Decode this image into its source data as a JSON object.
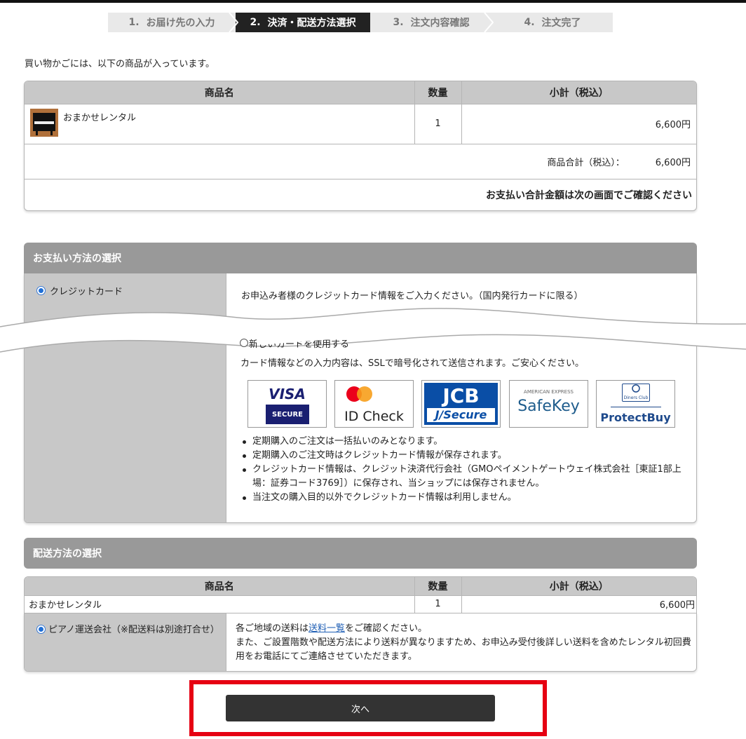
{
  "steps": [
    {
      "num": "1.",
      "label": "お届け先の入力"
    },
    {
      "num": "2.",
      "label": "決済・配送方法選択"
    },
    {
      "num": "3.",
      "label": "注文内容確認"
    },
    {
      "num": "4.",
      "label": "注文完了"
    }
  ],
  "intro_text": "買い物かごには、以下の商品が入っています。",
  "cart": {
    "headers": [
      "商品名",
      "数量",
      "小計（税込）"
    ],
    "item": {
      "name": "おまかせレンタル",
      "qty": "1",
      "subtotal": "6,600円",
      "thumb_icon": "piano-thumbnail"
    },
    "total_label": "商品合計（税込）：",
    "total_value": "6,600円",
    "notice": "お支払い合計金額は次の画面でご確認ください"
  },
  "payment": {
    "title": "お支払い方法の選択",
    "option_label": "クレジットカード",
    "instruction": "お申込み者様のクレジットカード情報をご入力ください。（国内発行カードに限る）",
    "new_card_label": "新しいカードを使用する",
    "ssl_text": "カード情報などの入力内容は、SSLで暗号化されて送信されます。ご安心ください。",
    "logos": [
      {
        "icon": "visa-secure-logo",
        "line1": "VISA",
        "line2": "SECURE"
      },
      {
        "icon": "mastercard-id-check-logo",
        "line1": "ID Check"
      },
      {
        "icon": "jcb-j-secure-logo",
        "line1": "JCB",
        "line2": "J/Secure"
      },
      {
        "icon": "amex-safekey-logo",
        "line1": "AMERICAN EXPRESS",
        "line2": "SafeKey"
      },
      {
        "icon": "diners-protectbuy-logo",
        "line1": "Diners Club",
        "line2": "ProtectBuy"
      }
    ],
    "notes": [
      "定期購入のご注文は一括払いのみとなります。",
      "定期購入のご注文時はクレジットカード情報が保存されます。",
      "クレジットカード情報は、クレジット決済代行会社（GMOペイメントゲートウェイ株式会社［東証1部上場：証券コード3769］）に保存され、当ショップには保存されません。",
      "当注文の購入目的以外でクレジットカード情報は利用しません。"
    ]
  },
  "shipping": {
    "title": "配送方法の選択",
    "headers": [
      "商品名",
      "数量",
      "小計（税込）"
    ],
    "item": {
      "name": "おまかせレンタル",
      "qty": "1",
      "subtotal": "6,600円"
    },
    "option_label": "ピアノ運送会社（※配送料は別途打合せ）",
    "desc_before_link": "各ご地域の送料は",
    "link_text": "送料一覧",
    "desc_after_link": "をご確認ください。",
    "desc_line2": "また、ご設置階数や配送方法により送料が異なりますため、お申込み受付後詳しい送料を含めたレンタル初回費用をお電話にてご連絡させていただきます。"
  },
  "next_button": "次へ",
  "colors": {
    "highlight": "#e60012",
    "button": "#333333",
    "header_gray": "#999999",
    "cell_gray": "#c8c8c8"
  }
}
